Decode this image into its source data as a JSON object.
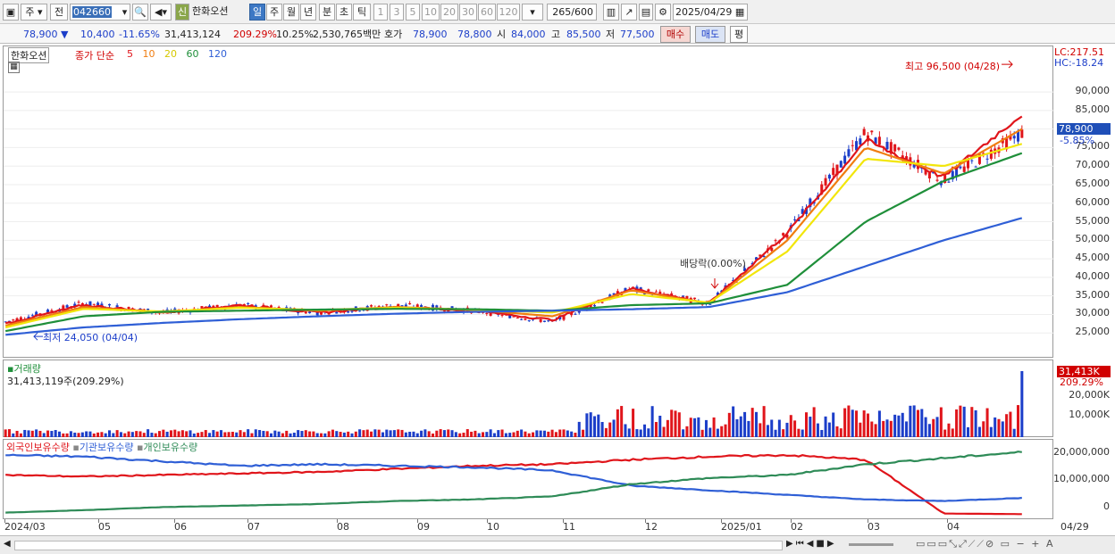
{
  "toolbar": {
    "market_label": "주",
    "prev_label": "전",
    "stock_code": "042660",
    "stock_name": "한화오션",
    "badge": "신",
    "periods": [
      "일",
      "주",
      "월",
      "년",
      "분",
      "초",
      "틱"
    ],
    "minute_options": [
      "1",
      "3",
      "5",
      "10",
      "20",
      "30",
      "60",
      "120"
    ],
    "count_value": "265",
    "count_max": "/600",
    "date": "2025/04/29"
  },
  "quote": {
    "price": "78,900",
    "change": "10,400",
    "change_pct": "-11.65%",
    "volume": "31,413,124",
    "volume_ratio": "209.29%",
    "turnover": "10.25%",
    "amount": "2,530,765백만",
    "hoga_label": "호가",
    "ask": "78,900",
    "bid": "78,800",
    "open_label": "시",
    "open": "84,000",
    "high_label": "고",
    "high": "85,500",
    "low_label": "저",
    "low": "77,500",
    "buy_label": "매수",
    "sell_label": "매도",
    "eval_label": "평"
  },
  "price_panel": {
    "name_tag": "한화오션",
    "legend_title": "종가 단순",
    "ma_periods": [
      "5",
      "10",
      "20",
      "60",
      "120"
    ],
    "ma_colors": [
      "#e0151b",
      "#f07d10",
      "#f2e60a",
      "#1f8f3a",
      "#2f5fd6"
    ],
    "lc": "LC:217.51",
    "hc": "HC:-18.24",
    "high_annot": "최고 96,500 (04/28)",
    "low_annot": "최저 24,050 (04/04)",
    "dividend_annot": "배당락(0.00%)",
    "current_tag": "78,900",
    "current_pct": "-5.85%",
    "y_ticks": [
      "90,000",
      "85,000",
      "80,000",
      "75,000",
      "70,000",
      "65,000",
      "60,000",
      "55,000",
      "50,000",
      "45,000",
      "40,000",
      "35,000",
      "30,000",
      "25,000"
    ]
  },
  "volume_panel": {
    "title": "거래량",
    "value_text": "31,413,119주(209.29%)",
    "current_tag": "31,413K",
    "current_pct": "209.29%",
    "y_ticks": [
      "20,000K",
      "10,000K"
    ]
  },
  "holding_panel": {
    "series": [
      {
        "name": "외국인보유수량",
        "color": "#e0151b"
      },
      {
        "name": "기관보유수량",
        "color": "#2f5fd6"
      },
      {
        "name": "개인보유수량",
        "color": "#2e8b57"
      }
    ],
    "y_ticks": [
      "20,000,000",
      "10,000,000",
      "0"
    ]
  },
  "x_axis": {
    "labels": [
      "2024/03",
      "05",
      "06",
      "07",
      "08",
      "09",
      "10",
      "11",
      "12",
      "2025/01",
      "02",
      "03",
      "04"
    ],
    "end_label": "04/29"
  },
  "chart_data": {
    "type": "candlestick",
    "title": "한화오션",
    "ylim": [
      22000,
      96500
    ],
    "x": [
      "2024/03",
      "05",
      "06",
      "07",
      "08",
      "09",
      "10",
      "11",
      "12",
      "2025/01",
      "02",
      "03",
      "04",
      "04/29"
    ],
    "close_approx": [
      28000,
      33000,
      30500,
      32500,
      30500,
      32500,
      31000,
      28000,
      37000,
      33000,
      52000,
      79000,
      66000,
      78900
    ],
    "series": [
      {
        "name": "5",
        "values": [
          27500,
          32500,
          30500,
          32500,
          30500,
          32000,
          31000,
          28500,
          37000,
          33000,
          52000,
          77000,
          67000,
          84000
        ]
      },
      {
        "name": "10",
        "values": [
          27000,
          32000,
          30500,
          32000,
          31000,
          32000,
          31200,
          29500,
          36500,
          33000,
          50000,
          75000,
          68000,
          80000
        ]
      },
      {
        "name": "20",
        "values": [
          26500,
          31500,
          30800,
          31800,
          31200,
          31800,
          31300,
          30500,
          35500,
          33200,
          47000,
          72000,
          70000,
          76000
        ]
      },
      {
        "name": "60",
        "values": [
          25500,
          29500,
          30700,
          31000,
          31300,
          31500,
          31400,
          31000,
          32500,
          33000,
          38000,
          55000,
          66000,
          73500
        ]
      },
      {
        "name": "120",
        "values": [
          24500,
          26500,
          27700,
          28700,
          29500,
          30200,
          30700,
          31000,
          31400,
          32000,
          36000,
          43000,
          50000,
          56000
        ]
      }
    ],
    "high_point": {
      "label": "최고 96,500 (04/28)",
      "value": 96500
    },
    "low_point": {
      "label": "최저 24,050 (04/04)",
      "value": 24050
    }
  }
}
